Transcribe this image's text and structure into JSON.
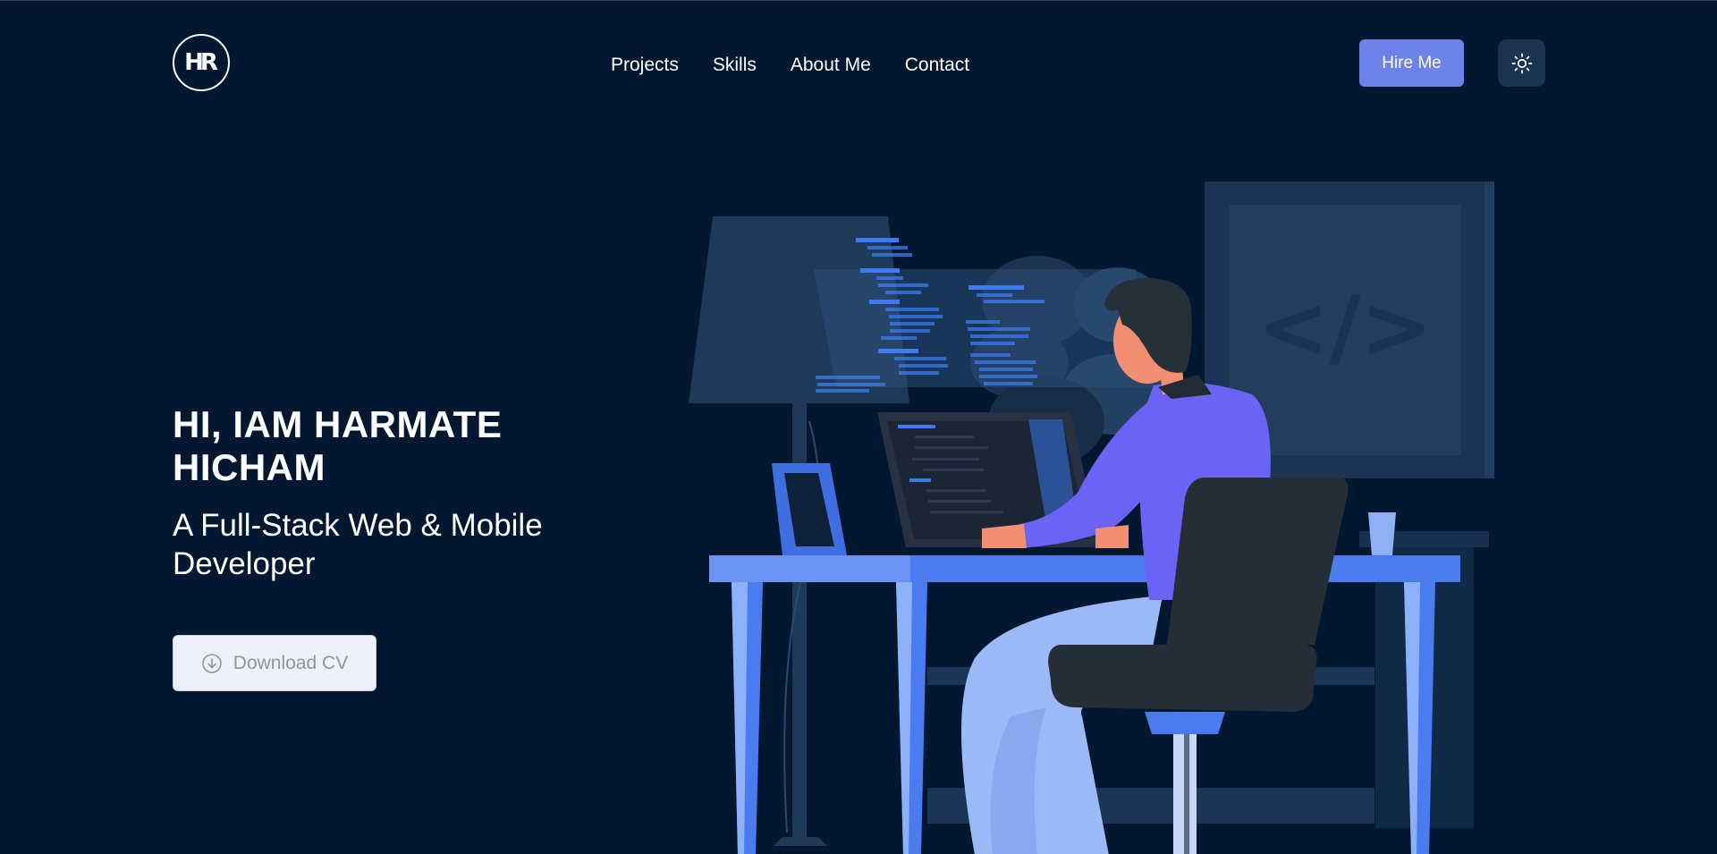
{
  "header": {
    "logo_text": "HR",
    "nav": [
      "Projects",
      "Skills",
      "About Me",
      "Contact"
    ],
    "hire_label": "Hire Me",
    "theme_icon": "sun-icon"
  },
  "hero": {
    "title": "HI, IAM HARMATE HICHAM",
    "subtitle": "A Full-Stack Web & Mobile Developer",
    "download_label": "Download CV",
    "download_icon": "download-circle-icon"
  },
  "illustration": {
    "frame_text": "</>"
  },
  "colors": {
    "background": "#021831",
    "accent": "#6d82e8",
    "desk_blue": "#4a7cf0",
    "shirt_purple": "#6b63f5"
  }
}
